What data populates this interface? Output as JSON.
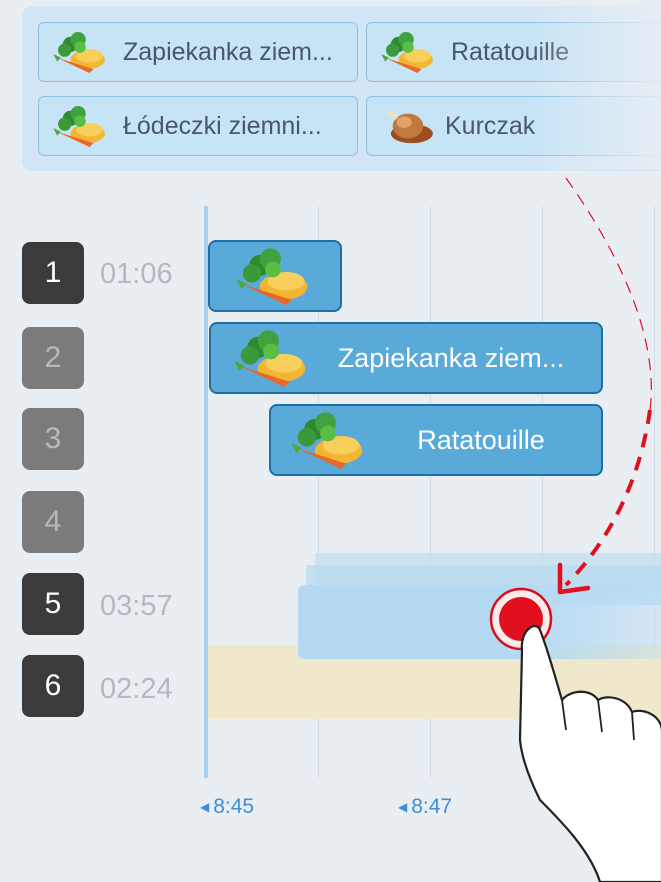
{
  "recipes": [
    {
      "label": "Zapiekanka ziem...",
      "icon": "vegetables-icon"
    },
    {
      "label": "Ratatouille",
      "icon": "vegetables-icon"
    },
    {
      "label": "Łódeczki ziemni...",
      "icon": "vegetables-icon"
    },
    {
      "label": "Kurczak",
      "icon": "chicken-icon"
    }
  ],
  "rows": [
    {
      "num": "1",
      "time": "01:06",
      "active": true
    },
    {
      "num": "2",
      "time": "",
      "active": false
    },
    {
      "num": "3",
      "time": "",
      "active": false
    },
    {
      "num": "4",
      "time": "",
      "active": false
    },
    {
      "num": "5",
      "time": "03:57",
      "active": true
    },
    {
      "num": "6",
      "time": "02:24",
      "active": true
    }
  ],
  "blocks": [
    {
      "label": "",
      "icon": "vegetables-icon"
    },
    {
      "label": "Zapiekanka ziem...",
      "icon": "vegetables-icon"
    },
    {
      "label": "Ratatouille",
      "icon": "vegetables-icon"
    }
  ],
  "axis": [
    "8:45",
    "8:47"
  ],
  "colors": {
    "accent": "#3f8fd6",
    "block": "#5aaad9",
    "drag_arrow": "#e0101e"
  }
}
